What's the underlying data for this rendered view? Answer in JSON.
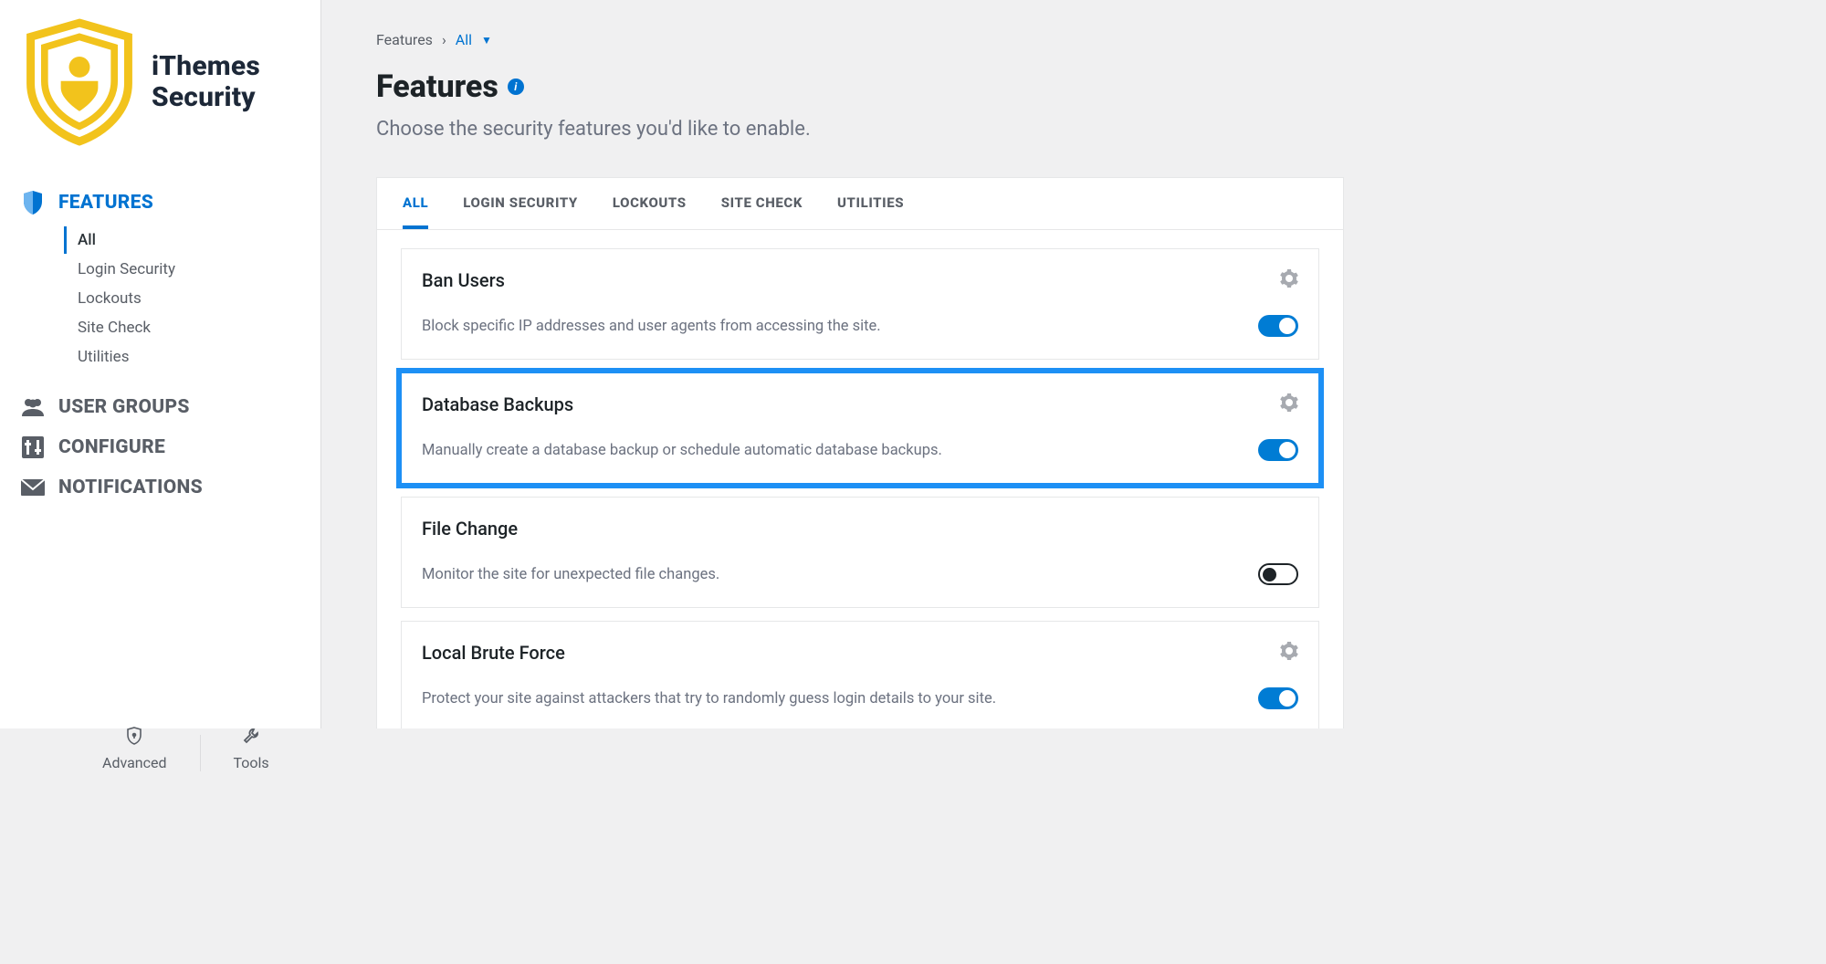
{
  "brand": {
    "line1": "iThemes",
    "line2": "Security"
  },
  "sidebar": {
    "items": [
      {
        "label": "FEATURES",
        "icon": "shield-icon",
        "active": true
      },
      {
        "label": "USER GROUPS",
        "icon": "users-icon",
        "active": false
      },
      {
        "label": "CONFIGURE",
        "icon": "sliders-icon",
        "active": false
      },
      {
        "label": "NOTIFICATIONS",
        "icon": "mail-icon",
        "active": false
      }
    ],
    "subitems": [
      {
        "label": "All",
        "active": true
      },
      {
        "label": "Login Security",
        "active": false
      },
      {
        "label": "Lockouts",
        "active": false
      },
      {
        "label": "Site Check",
        "active": false
      },
      {
        "label": "Utilities",
        "active": false
      }
    ],
    "footer": {
      "advanced": "Advanced",
      "tools": "Tools"
    }
  },
  "breadcrumb": {
    "root": "Features",
    "current": "All"
  },
  "header": {
    "title": "Features",
    "subtitle": "Choose the security features you'd like to enable."
  },
  "tabs": [
    {
      "label": "ALL",
      "active": true
    },
    {
      "label": "LOGIN SECURITY",
      "active": false
    },
    {
      "label": "LOCKOUTS",
      "active": false
    },
    {
      "label": "SITE CHECK",
      "active": false
    },
    {
      "label": "UTILITIES",
      "active": false
    }
  ],
  "cards": [
    {
      "title": "Ban Users",
      "desc": "Block specific IP addresses and user agents from accessing the site.",
      "enabled": true,
      "highlight": false
    },
    {
      "title": "Database Backups",
      "desc": "Manually create a database backup or schedule automatic database backups.",
      "enabled": true,
      "highlight": true
    },
    {
      "title": "File Change",
      "desc": "Monitor the site for unexpected file changes.",
      "enabled": false,
      "highlight": false
    },
    {
      "title": "Local Brute Force",
      "desc": "Protect your site against attackers that try to randomly guess login details to your site.",
      "enabled": true,
      "highlight": false
    }
  ]
}
